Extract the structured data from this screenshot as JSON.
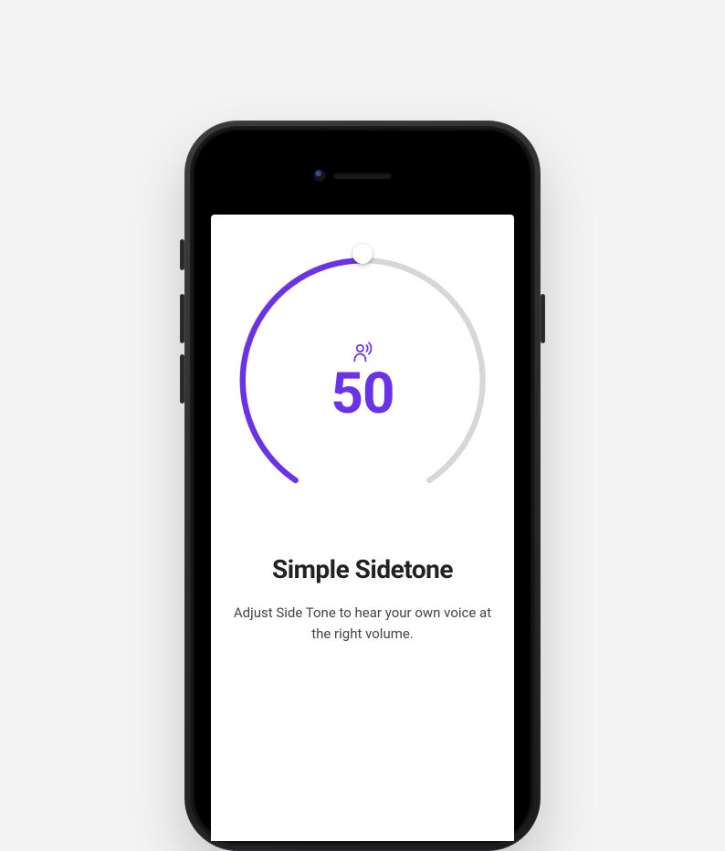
{
  "colors": {
    "accent": "#6b33e6",
    "track": "#d7d7da",
    "thumb": "#ffffff"
  },
  "sidetone": {
    "value": "50",
    "min": 0,
    "max": 100
  },
  "feature": {
    "title": "Simple Sidetone",
    "description": "Adjust Side Tone to hear your own voice at the right volume."
  },
  "icon_name": "voice-broadcast-icon"
}
